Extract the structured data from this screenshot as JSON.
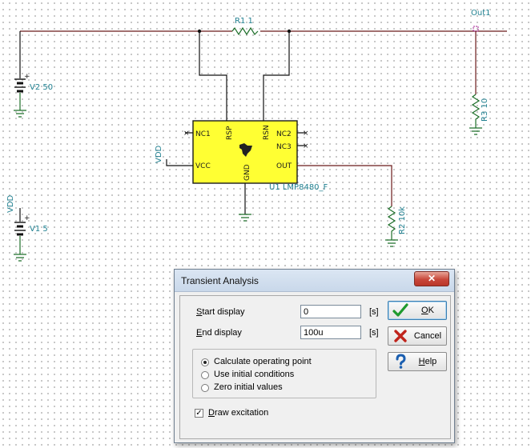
{
  "schematic": {
    "r1_label": "R1 1",
    "out_label": "Out1",
    "v2_label": "V2 50",
    "r3_label": "R3 10",
    "vdd_label_chip": "VDD",
    "vdd_label_v1": "VDD",
    "v1_label": "V1 5",
    "r2_label": "R2 10k",
    "ic": {
      "name_label": "U1 LMP8480_F",
      "pin_nc1": "NC1",
      "pin_vcc": "VCC",
      "pin_rsp": "RSP",
      "pin_rsn": "RSN",
      "pin_gnd": "GND",
      "pin_nc2": "NC2",
      "pin_nc3": "NC3",
      "pin_out": "OUT",
      "body_color": "#ffff33"
    },
    "plus_sign": "+"
  },
  "dialog": {
    "title": "Transient Analysis",
    "close_glyph": "✕",
    "start_display": {
      "pre": "",
      "mnemonic": "S",
      "post": "tart display",
      "value": "0",
      "unit": "[s]"
    },
    "end_display": {
      "pre": "",
      "mnemonic": "E",
      "post": "nd display",
      "value": "100u",
      "unit": "[s]"
    },
    "options": [
      {
        "label": "Calculate operating point",
        "selected": true
      },
      {
        "label": "Use initial conditions",
        "selected": false
      },
      {
        "label": "Zero initial values",
        "selected": false
      }
    ],
    "draw_excitation": {
      "pre": "",
      "mnemonic": "D",
      "post": "raw excitation",
      "checked": true,
      "check_glyph": "✓"
    },
    "buttons": {
      "ok": {
        "pre": "",
        "mnemonic": "O",
        "post": "K",
        "icon": "checkmark-icon"
      },
      "cancel": {
        "pre": "",
        "mnemonic": "",
        "post": "Cancel",
        "icon": "x-icon"
      },
      "help": {
        "pre": "",
        "mnemonic": "H",
        "post": "elp",
        "icon": "question-icon"
      }
    }
  }
}
